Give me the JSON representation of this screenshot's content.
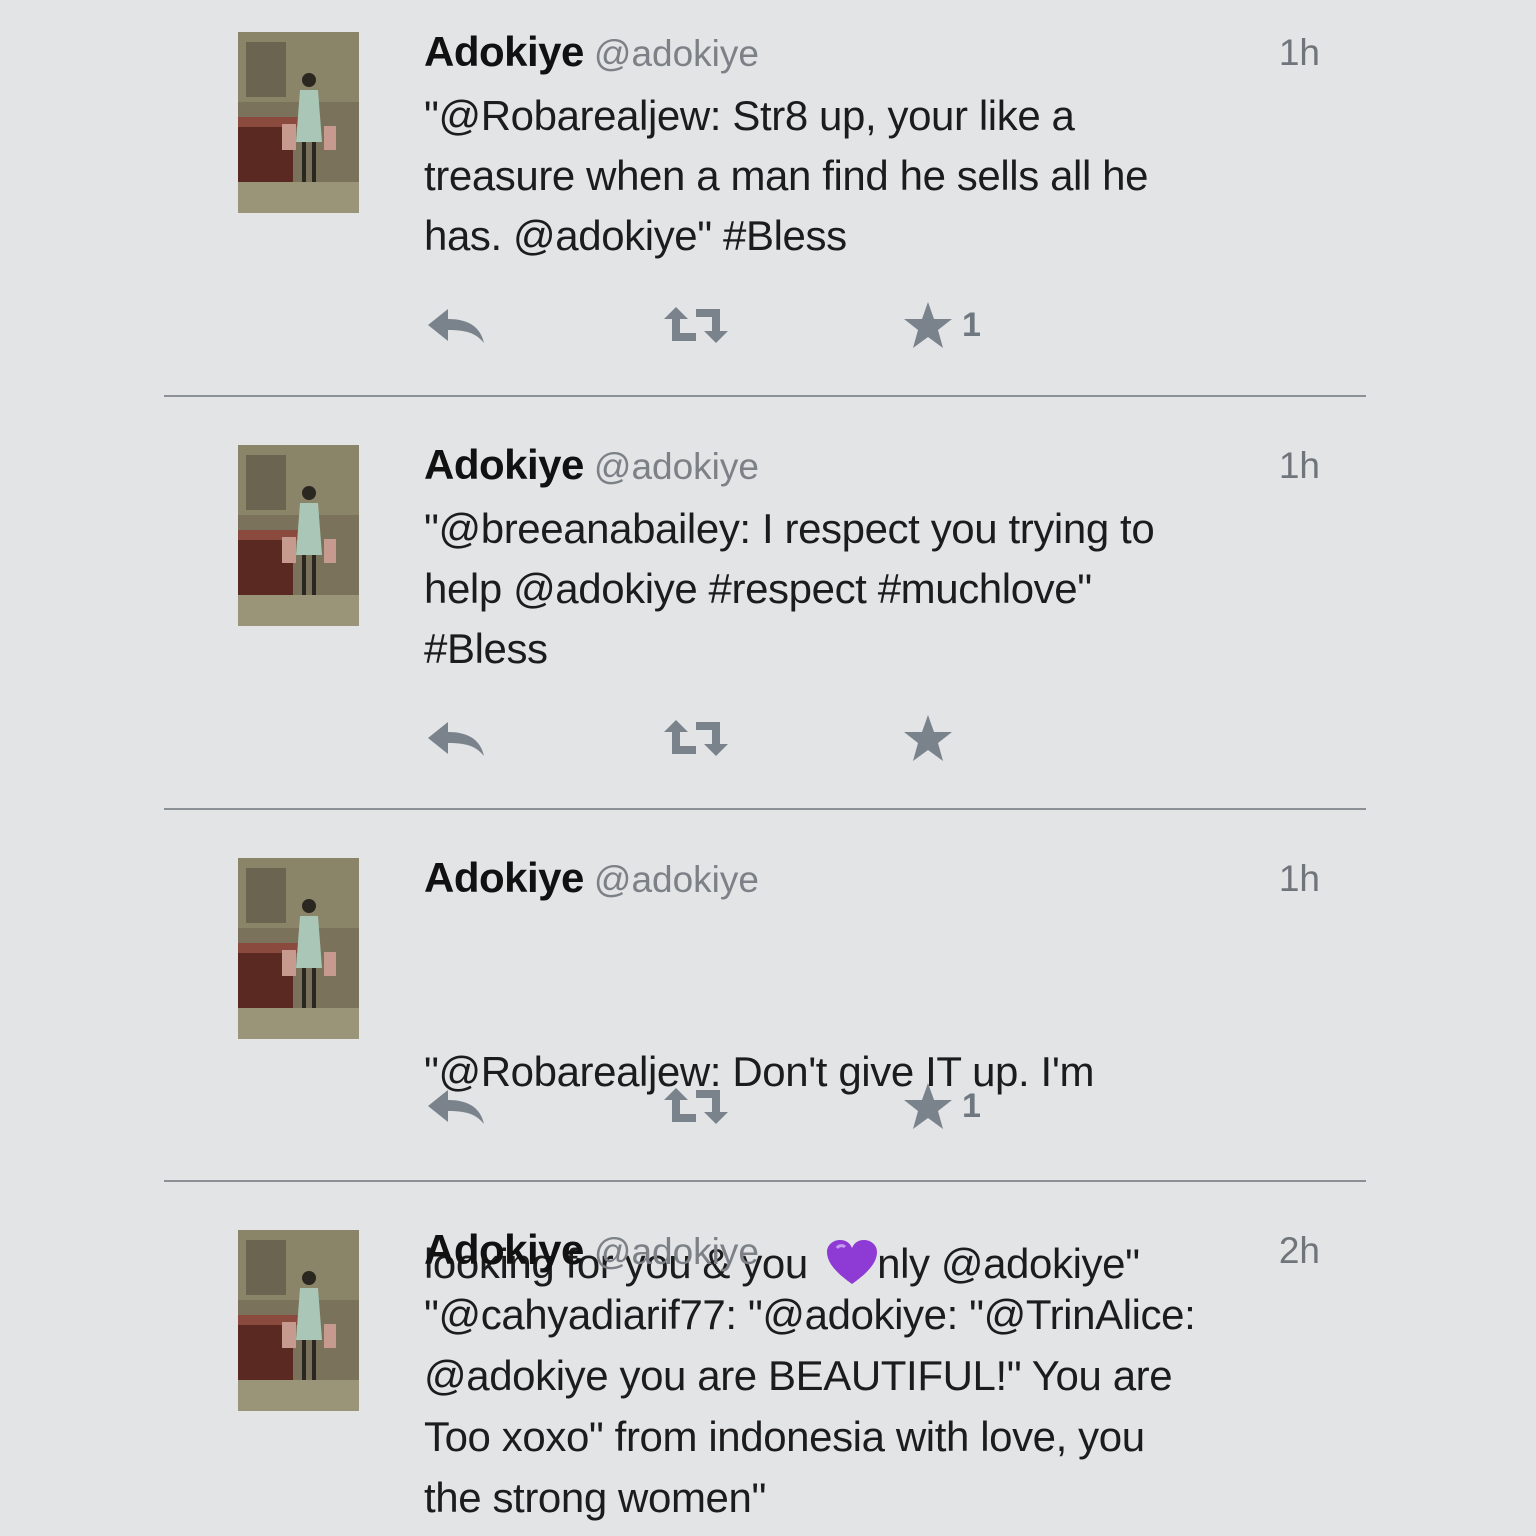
{
  "tweets": [
    {
      "name": "Adokiye",
      "handle": "@adokiye",
      "time": "1h",
      "text": "\"@Robarealjew: Str8 up, your like a\ntreasure when a man find he sells all he\nhas. @adokiye\" #Bless",
      "favorite_count": "1"
    },
    {
      "name": "Adokiye",
      "handle": "@adokiye",
      "time": "1h",
      "text": "\"@breeanabailey: I respect you trying to\nhelp @adokiye #respect #muchlove\"\n#Bless",
      "favorite_count": ""
    },
    {
      "name": "Adokiye",
      "handle": "@adokiye",
      "time": "1h",
      "text_line1": "\"@Robarealjew: Don't give IT up. I'm",
      "text_line2_before": "looking for you & you ",
      "text_line2_after": "nly @adokiye\"",
      "favorite_count": "1"
    },
    {
      "name": "Adokiye",
      "handle": "@adokiye",
      "time": "2h",
      "text": "\"@cahyadiarif77: \"@adokiye: \"@TrinAlice:\n@adokiye you are BEAUTIFUL!\" You are\nToo xoxo\" from indonesia with love, you\nthe strong women\"",
      "favorite_count": ""
    }
  ],
  "icons": {
    "reply": "reply-icon",
    "retweet": "retweet-icon",
    "favorite": "star-icon",
    "emoji": "purple-heart-icon"
  },
  "colors": {
    "background": "#e3e4e6",
    "icon": "#7a838c",
    "divider": "#8b9097",
    "heart": "#8e3bd6"
  }
}
